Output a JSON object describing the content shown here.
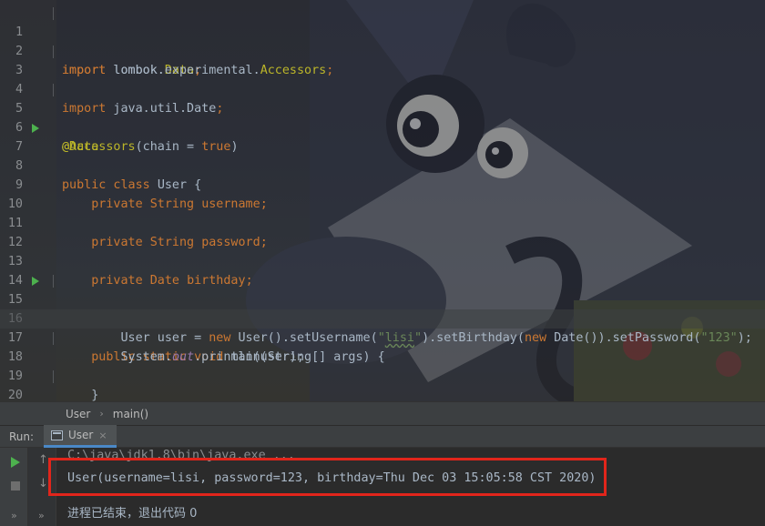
{
  "editor": {
    "lines": [
      {
        "n": "1"
      },
      {
        "n": "2"
      },
      {
        "n": "3"
      },
      {
        "n": "4"
      },
      {
        "n": "5"
      },
      {
        "n": "6"
      },
      {
        "n": "7"
      },
      {
        "n": "8"
      },
      {
        "n": "9"
      },
      {
        "n": "10"
      },
      {
        "n": "11"
      },
      {
        "n": "12"
      },
      {
        "n": "13"
      },
      {
        "n": "14"
      },
      {
        "n": "15"
      },
      {
        "n": "16"
      },
      {
        "n": "17"
      },
      {
        "n": "18"
      },
      {
        "n": "19"
      },
      {
        "n": "20"
      }
    ],
    "tokens": {
      "import": "import",
      "import1_path": " lombok.",
      "import1_cls": "Data",
      "import2_path": " lombok.experimental.",
      "import2_cls": "Accessors",
      "import3_path": " java.util.Date",
      "semi": ";",
      "ann_data": "@Data",
      "ann_accessors": "@Accessors",
      "chain_args_open": "(chain = ",
      "true": "true",
      "paren_close": ")",
      "public_class": "public class ",
      "class_decl": "User {",
      "private": "private ",
      "string_type": "String ",
      "date_type": "Date ",
      "field_username": "username",
      "field_password": "password",
      "field_birthday": "birthday",
      "public_static_void": "public static void ",
      "main_sig": "main(String[] args) {",
      "user_decl": "User user = ",
      "new": "new ",
      "user_ctor": "User().setUsername(",
      "str_lisi_q": "\"",
      "str_lisi": "lisi",
      "set_birthday": ").setBirthday(",
      "date_ctor": "Date()).setPassword(",
      "str_123": "\"123\"",
      "end_stmt": ");",
      "system": "System.",
      "out": "out",
      "println": ".println(user);",
      "close_brace": "}",
      "indent1": "    ",
      "indent2": "        "
    }
  },
  "breadcrumb": {
    "items": [
      "User",
      "main()"
    ],
    "separator": "›"
  },
  "run_panel": {
    "label": "Run:",
    "tab_label": "User",
    "tab_close": "×",
    "more": "»",
    "up_arrow": "↑",
    "down_arrow": "↓",
    "console": {
      "command": "C:\\java\\jdk1.8\\bin\\java.exe ...",
      "output": "User(username=lisi, password=123, birthday=Thu Dec 03 15:05:58 CST 2020)",
      "exit": "进程已结束，退出代码 0"
    }
  },
  "colors": {
    "keyword": "#cc7832",
    "annotation": "#bbb529",
    "string": "#6a8759",
    "field": "#9876aa",
    "default_text": "#a9b7c6",
    "run_icon": "#4db14e",
    "highlight_box": "#e1251b"
  },
  "icons": {
    "run_gutter": "run-triangle-icon",
    "play": "play-icon",
    "stop": "stop-icon",
    "tab": "console-tab-icon"
  }
}
